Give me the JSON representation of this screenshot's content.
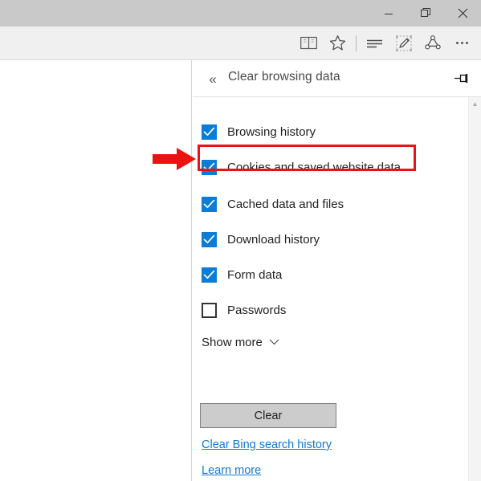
{
  "window": {
    "controls": [
      {
        "name": "minimize",
        "glyph": "minimize-icon"
      },
      {
        "name": "restore",
        "glyph": "restore-icon"
      },
      {
        "name": "close",
        "glyph": "close-icon"
      }
    ]
  },
  "toolbar": {
    "icons": [
      {
        "name": "reading-view-icon",
        "title": "Reading view"
      },
      {
        "name": "favorites-star-icon",
        "title": "Add to favorites or reading list"
      },
      {
        "name": "hub-icon",
        "title": "Hub"
      },
      {
        "name": "web-note-icon",
        "title": "Make a Web Note"
      },
      {
        "name": "share-icon",
        "title": "Share"
      },
      {
        "name": "more-icon",
        "title": "More"
      }
    ]
  },
  "panel": {
    "back_label": "«",
    "title": "Clear browsing data",
    "pin_label": "pin-icon",
    "items": [
      {
        "label": "Browsing history",
        "checked": true
      },
      {
        "label": "Cookies and saved website data",
        "checked": true
      },
      {
        "label": "Cached data and files",
        "checked": true
      },
      {
        "label": "Download history",
        "checked": true
      },
      {
        "label": "Form data",
        "checked": true
      },
      {
        "label": "Passwords",
        "checked": false
      }
    ],
    "show_more_label": "Show more",
    "show_more_chevron": "⌄",
    "clear_button_label": "Clear",
    "links": [
      {
        "label": "Clear Bing search history"
      },
      {
        "label": "Learn more"
      }
    ]
  },
  "annotations": {
    "highlight_color": "#ee1111",
    "highlight_target": "Cookies and saved website data",
    "arrow_direction": "right"
  }
}
